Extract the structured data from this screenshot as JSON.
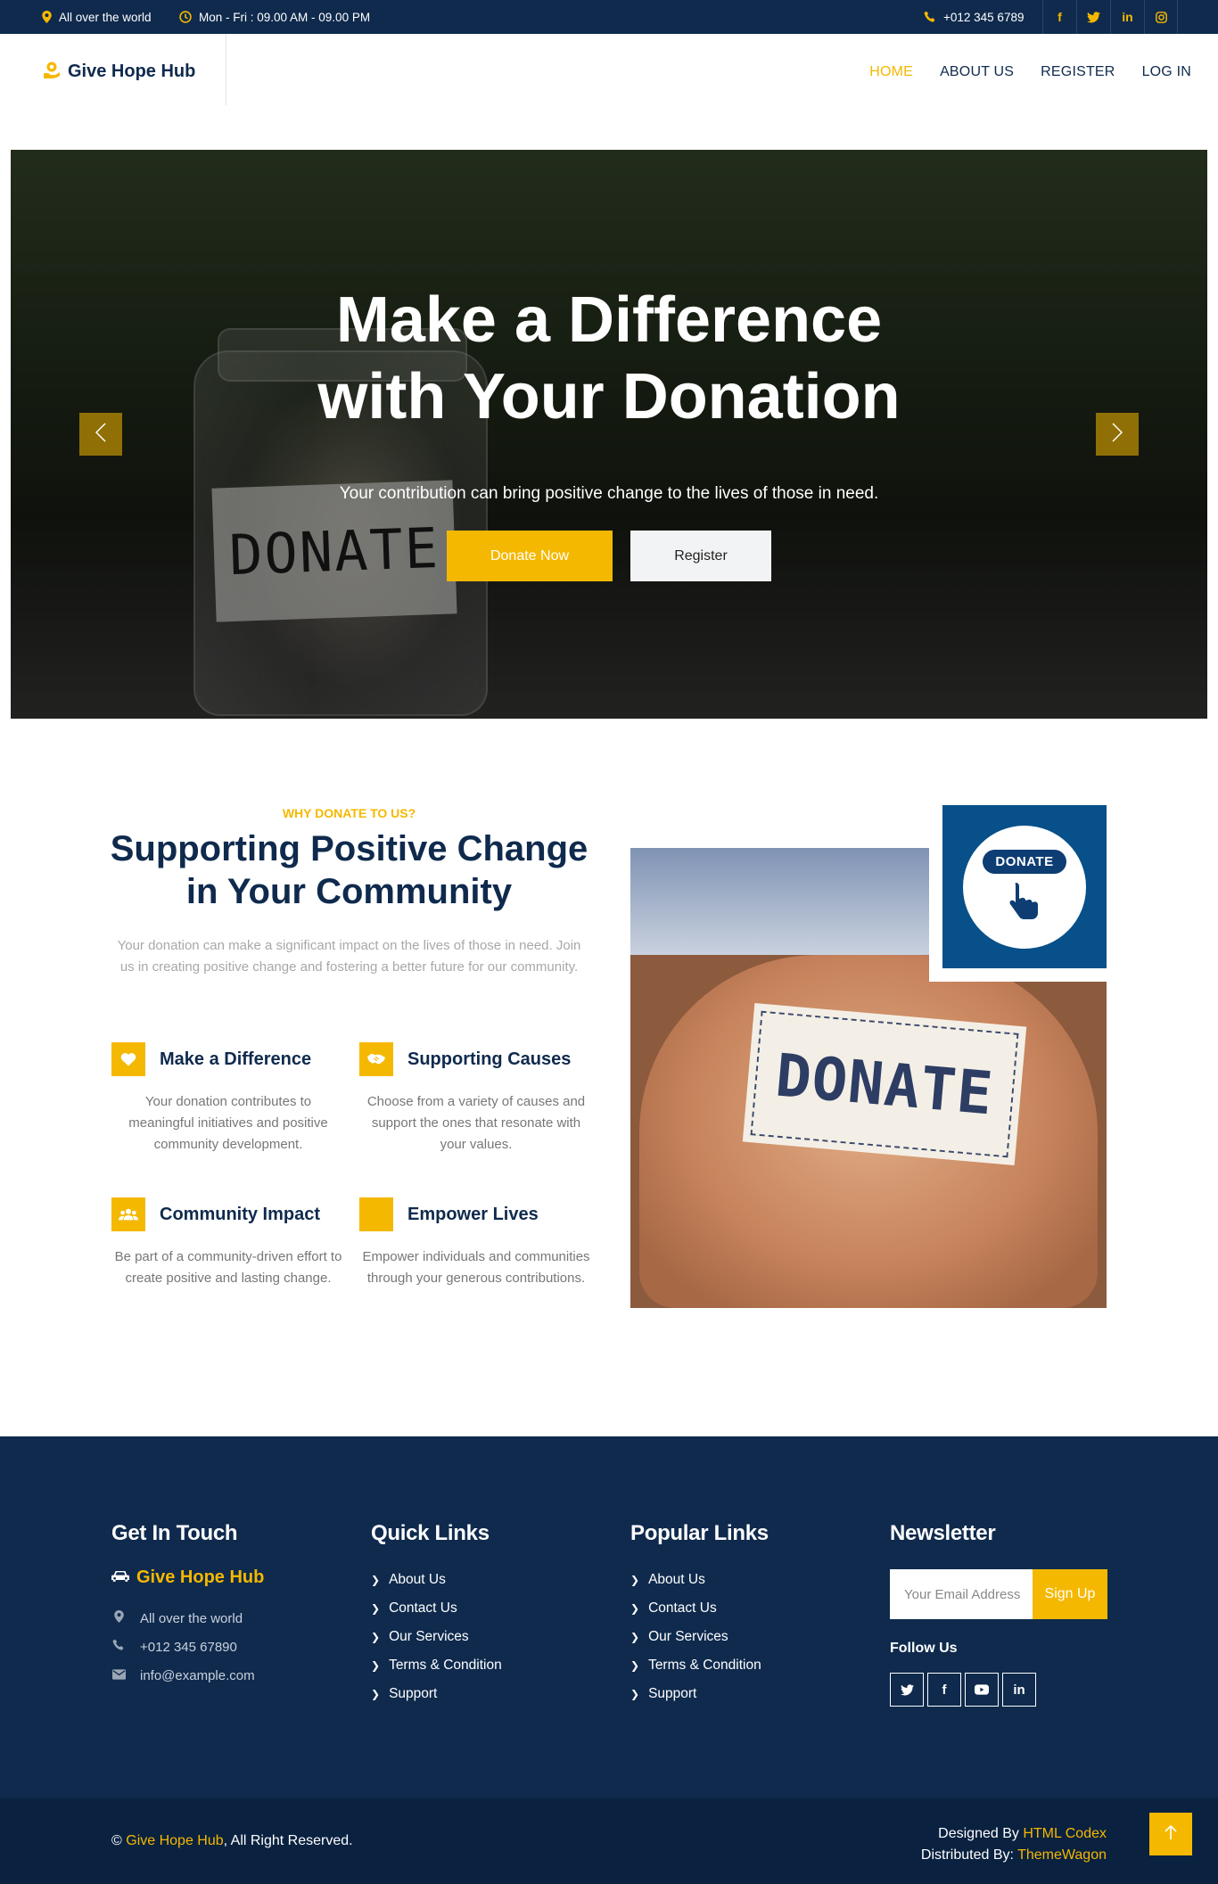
{
  "topbar": {
    "location": "All over the world",
    "hours": "Mon - Fri : 09.00 AM - 09.00 PM",
    "phone": "+012 345 6789",
    "social": [
      "f",
      "t",
      "in",
      "ig"
    ]
  },
  "navbar": {
    "brand": "Give Hope Hub",
    "links": [
      "HOME",
      "ABOUT US",
      "REGISTER",
      "LOG IN"
    ],
    "active": "HOME"
  },
  "hero": {
    "title_line1": "Make a Difference",
    "title_line2": "with Your Donation",
    "subtitle": "Your contribution can bring positive change to the lives of those in need.",
    "donate_button": "Donate Now",
    "register_button": "Register",
    "jar_label": "DONATE"
  },
  "about": {
    "tag": "WHY DONATE TO US?",
    "title": "Supporting Positive Change in Your Community",
    "description": "Your donation can make a significant impact on the lives of those in need. Join us in creating positive change and fostering a better future for our community.",
    "features": [
      {
        "title": "Make a Difference",
        "text": "Your donation contributes to meaningful initiatives and positive community development.",
        "icon": "heart-icon"
      },
      {
        "title": "Supporting Causes",
        "text": "Choose from a variety of causes and support the ones that resonate with your values.",
        "icon": "handshake-icon"
      },
      {
        "title": "Community Impact",
        "text": "Be part of a community-driven effort to create positive and lasting change.",
        "icon": "users-icon"
      },
      {
        "title": "Empower Lives",
        "text": "Empower individuals and communities through your generous contributions.",
        "icon": "empty-icon"
      }
    ],
    "image_note": "DONATE",
    "badge_label": "DONATE"
  },
  "footer": {
    "get_in_touch": {
      "title": "Get In Touch",
      "brand": "Give Hope Hub",
      "location": "All over the world",
      "phone": "+012 345 67890",
      "email": "info@example.com"
    },
    "quick_links": {
      "title": "Quick Links",
      "items": [
        "About Us",
        "Contact Us",
        "Our Services",
        "Terms & Condition",
        "Support"
      ]
    },
    "popular_links": {
      "title": "Popular Links",
      "items": [
        "About Us",
        "Contact Us",
        "Our Services",
        "Terms & Condition",
        "Support"
      ]
    },
    "newsletter": {
      "title": "Newsletter",
      "placeholder": "Your Email Address",
      "button": "Sign Up",
      "follow": "Follow Us",
      "social": [
        "t",
        "f",
        "yt",
        "in"
      ]
    }
  },
  "copyright": {
    "symbol": "©",
    "brand": "Give Hope Hub",
    "rights": ", All Right Reserved.",
    "designed_prefix": "Designed By ",
    "designed_by": "HTML Codex",
    "distributed_prefix": "Distributed By: ",
    "distributed_by": "ThemeWagon"
  },
  "colors": {
    "accent": "#f5b800",
    "navy": "#0f2a4d",
    "badge_blue": "#07508a"
  }
}
